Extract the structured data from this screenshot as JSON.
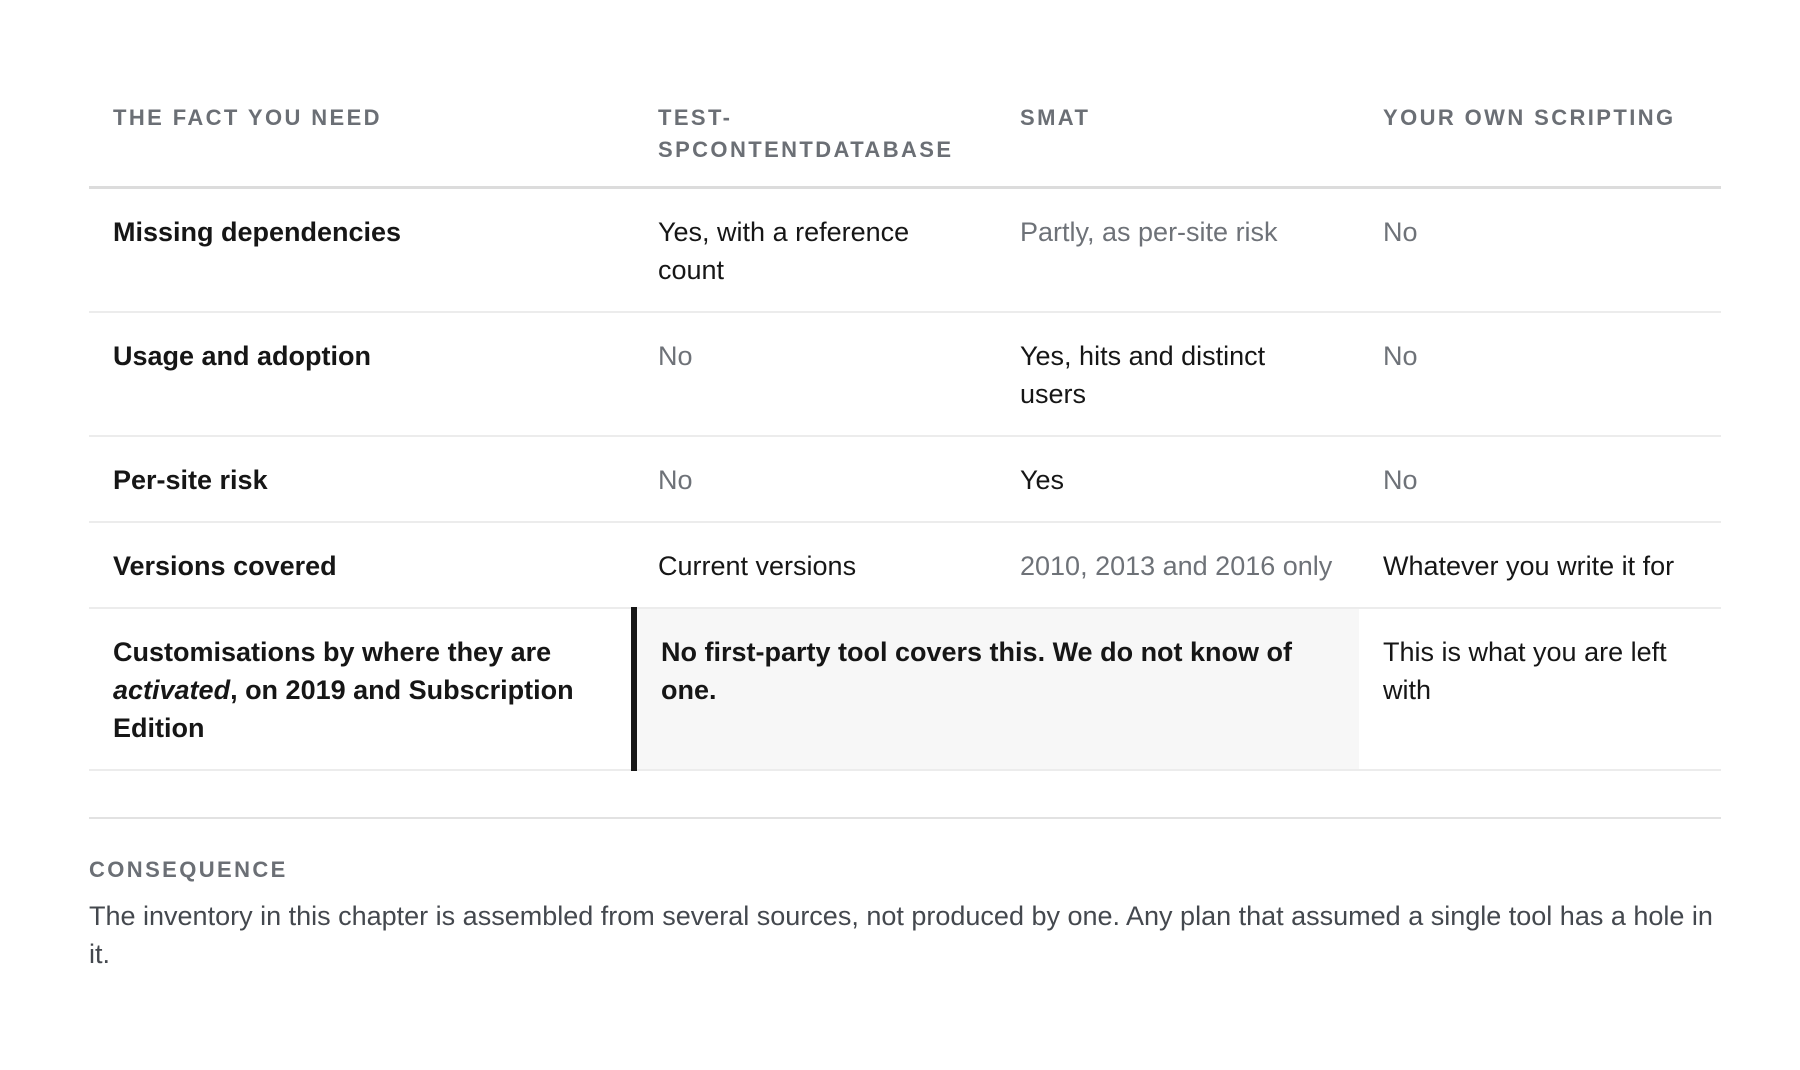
{
  "table": {
    "headers": [
      "THE FACT YOU NEED",
      "TEST-SPCONTENTDATABASE",
      "SMAT",
      "YOUR OWN SCRIPTING"
    ],
    "rows": [
      {
        "fact": "Missing dependencies",
        "test_spcontentdatabase": "Yes, with a reference count",
        "smat": "Partly, as per-site risk",
        "own_scripting": "No"
      },
      {
        "fact": "Usage and adoption",
        "test_spcontentdatabase": "No",
        "smat": "Yes, hits and distinct users",
        "own_scripting": "No"
      },
      {
        "fact": "Per-site risk",
        "test_spcontentdatabase": "No",
        "smat": "Yes",
        "own_scripting": "No"
      },
      {
        "fact": "Versions covered",
        "test_spcontentdatabase": "Current versions",
        "smat": "2010, 2013 and 2016 only",
        "own_scripting": "Whatever you write it for"
      },
      {
        "fact_part1": "Customisations by where they are ",
        "fact_emphasis": "activated",
        "fact_part2": ", on 2019 and Subscription Edition",
        "gap_note": "No first-party tool covers this. We do not know of one.",
        "own_scripting": "This is what you are left with"
      }
    ]
  },
  "consequence": {
    "label": "CONSEQUENCE",
    "text": "The inventory in this chapter is assembled from several sources, not produced by one. Any plan that assumed a single tool has a hole in it."
  }
}
